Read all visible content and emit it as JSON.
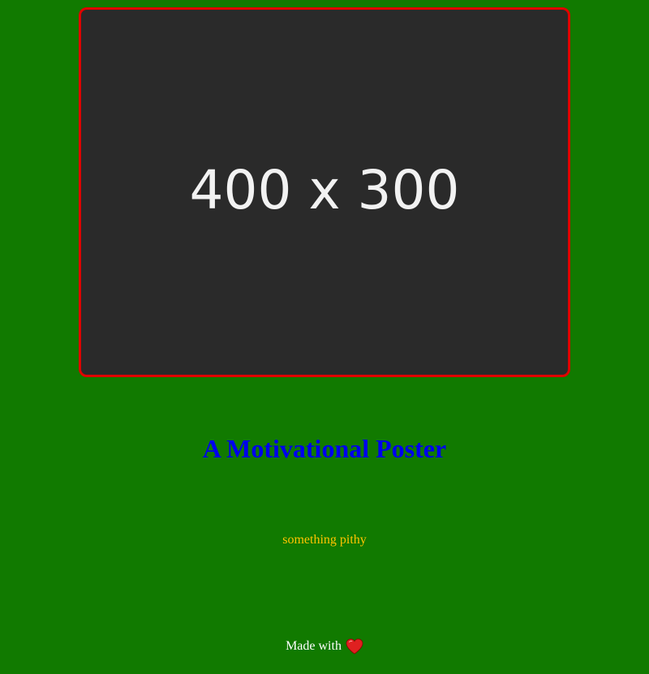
{
  "poster": {
    "image_placeholder_text": "400 x 300",
    "title": "A Motivational Poster",
    "tagline": "something pithy",
    "border_color": "#e00000"
  },
  "footer": {
    "made_with_text": "Made with",
    "icon": "heart-icon"
  },
  "colors": {
    "background": "#117a00",
    "title": "#0000ee",
    "tagline": "#ffc400",
    "footer_text": "#ffffff",
    "heart": "#e02020"
  }
}
